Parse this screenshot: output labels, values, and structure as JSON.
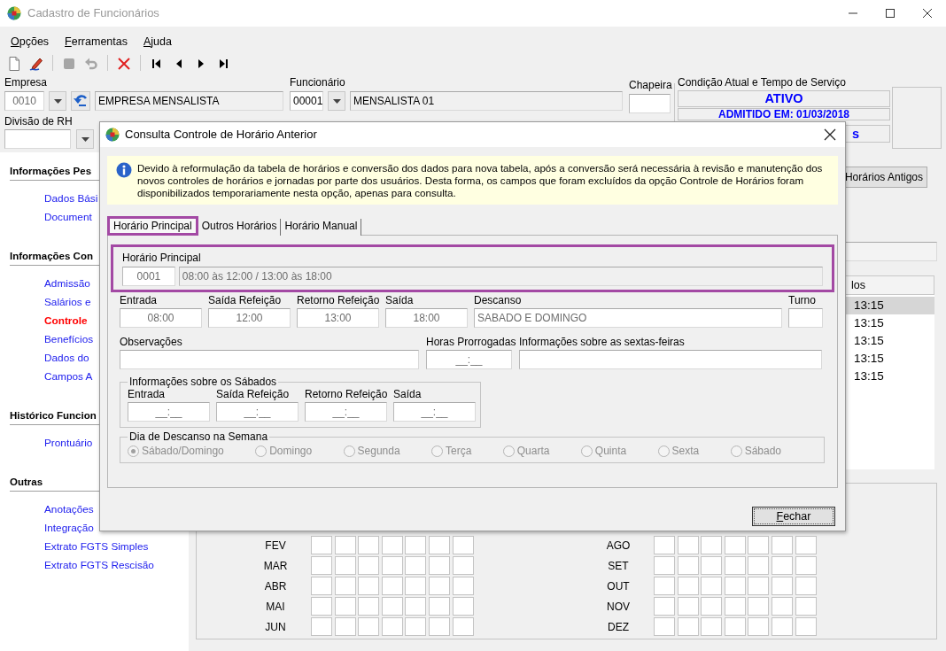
{
  "window": {
    "title": "Cadastro de Funcionários"
  },
  "menu": [
    {
      "label": "Opções"
    },
    {
      "label": "Ferramentas"
    },
    {
      "label": "Ajuda"
    }
  ],
  "toolbar": [
    {
      "kind": "new",
      "disabled": false
    },
    {
      "kind": "edit",
      "disabled": false
    },
    {
      "kind": "separator"
    },
    {
      "kind": "save",
      "disabled": true
    },
    {
      "kind": "undo",
      "disabled": true
    },
    {
      "kind": "separator"
    },
    {
      "kind": "delete",
      "disabled": false
    },
    {
      "kind": "separator"
    },
    {
      "kind": "first",
      "disabled": false
    },
    {
      "kind": "prev",
      "disabled": false
    },
    {
      "kind": "next",
      "disabled": false
    },
    {
      "kind": "last",
      "disabled": false
    }
  ],
  "form": {
    "empresa": {
      "label": "Empresa",
      "code": "0010",
      "name": "EMPRESA MENSALISTA"
    },
    "divisao": {
      "label": "Divisão de RH"
    },
    "funcionario": {
      "label": "Funcionário",
      "code": "00001",
      "name": "MENSALISTA 01"
    },
    "chapeira": {
      "label": "Chapeira"
    },
    "condicao": {
      "label": "Condição Atual e Tempo de Serviço",
      "lines": [
        "ATIVO",
        "ADMITIDO EM: 01/03/2018",
        "s"
      ]
    }
  },
  "sidebar": [
    {
      "title": "Informações Pes",
      "items": [
        {
          "label": "Dados Bási",
          "selected": false
        },
        {
          "label": "Document",
          "selected": false
        }
      ]
    },
    {
      "title": "Informações Con",
      "items": [
        {
          "label": "Admissão",
          "selected": false
        },
        {
          "label": "Salários e",
          "selected": false
        },
        {
          "label": "Controle",
          "selected": true
        },
        {
          "label": "Benefícios",
          "selected": false
        },
        {
          "label": "Dados do",
          "selected": false
        },
        {
          "label": "Campos A",
          "selected": false
        }
      ]
    },
    {
      "title": "Histórico Funcion",
      "items": [
        {
          "label": "Prontuário",
          "selected": false
        }
      ]
    },
    {
      "title": "Outras",
      "items": [
        {
          "label": "Anotações",
          "selected": false
        },
        {
          "label": "Integração",
          "selected": false
        },
        {
          "label": "Extrato FGTS Simples",
          "selected": false
        },
        {
          "label": "Extrato FGTS Rescisão",
          "selected": false
        }
      ]
    }
  ],
  "content": {
    "side_button": "Horários Antigos",
    "table": {
      "column_header": "los",
      "rows": [
        {
          "text": "13:15",
          "selected": true
        },
        {
          "text": "13:15",
          "selected": false
        },
        {
          "text": "13:15",
          "selected": false
        },
        {
          "text": "13:15",
          "selected": false
        },
        {
          "text": "13:15",
          "selected": false
        }
      ]
    },
    "calendar": {
      "left": [
        "FEV",
        "MAR",
        "ABR",
        "MAI",
        "JUN"
      ],
      "right": [
        "AGO",
        "SET",
        "OUT",
        "NOV",
        "DEZ"
      ]
    }
  },
  "dialog": {
    "title": "Consulta Controle de Horário Anterior",
    "info": "Devido à reformulação da tabela de horários e conversão dos dados para nova tabela, após a conversão será necessária à revisão e manutenção dos novos controles de horários e jornadas por parte dos usuários. Desta forma, os campos que foram excluídos da opção Controle de Horários foram disponibilizados temporariamente nesta opção, apenas para consulta.",
    "tabs": [
      {
        "label": "Horário Principal",
        "selected": true,
        "highlighted": true
      },
      {
        "label": "Outros Horários",
        "selected": false,
        "highlighted": false
      },
      {
        "label": "Horário Manual",
        "selected": false,
        "highlighted": false
      }
    ],
    "horario_principal": {
      "label": "Horário Principal",
      "code": "0001",
      "description": "08:00 às 12:00 / 13:00 às 18:00",
      "highlighted": true
    },
    "times": [
      {
        "label": "Entrada",
        "value": "08:00"
      },
      {
        "label": "Saída Refeição",
        "value": "12:00"
      },
      {
        "label": "Retorno Refeição",
        "value": "13:00"
      },
      {
        "label": "Saída",
        "value": "18:00"
      },
      {
        "label": "Descanso",
        "value": "SABADO E DOMINGO"
      },
      {
        "label": "Turno"
      }
    ],
    "extra": [
      {
        "label": "Observações"
      },
      {
        "label": "Horas Prorrogadas",
        "value": "__:__"
      },
      {
        "label": "Informações sobre as sextas-feiras"
      }
    ],
    "sabados": {
      "title": "Informações sobre os Sábados",
      "fields": [
        {
          "label": "Entrada",
          "value": "__:__"
        },
        {
          "label": "Saída Refeição",
          "value": "__:__"
        },
        {
          "label": "Retorno Refeição",
          "value": "__:__"
        },
        {
          "label": "Saída",
          "value": "__:__"
        }
      ]
    },
    "descanso_semana": {
      "title": "Dia de Descanso na Semana",
      "disabled": true,
      "options": [
        {
          "label": "Sábado/Domingo",
          "selected": true
        },
        {
          "label": "Domingo",
          "selected": false
        },
        {
          "label": "Segunda",
          "selected": false
        },
        {
          "label": "Terça",
          "selected": false
        },
        {
          "label": "Quarta",
          "selected": false
        },
        {
          "label": "Quinta",
          "selected": false
        },
        {
          "label": "Sexta",
          "selected": false
        },
        {
          "label": "Sábado",
          "selected": false
        }
      ]
    },
    "close_button": "Fechar"
  }
}
